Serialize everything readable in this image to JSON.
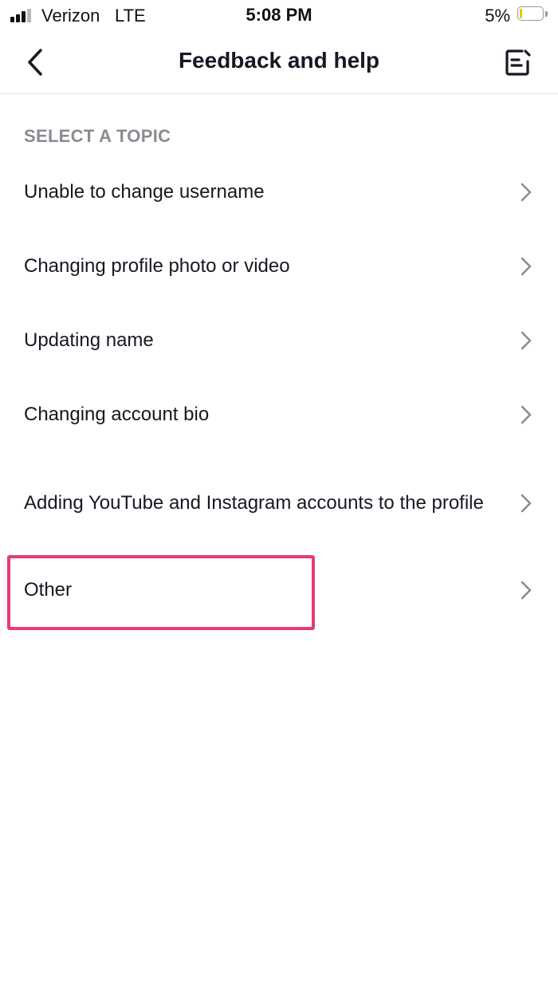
{
  "status_bar": {
    "carrier": "Verizon",
    "network": "LTE",
    "time": "5:08 PM",
    "battery_percent": "5%",
    "battery_level": 0.05,
    "signal_icon": "cellular-signal-icon",
    "battery_icon": "battery-low-icon"
  },
  "nav": {
    "title": "Feedback and help",
    "back_icon": "chevron-left-icon",
    "compose_icon": "edit-note-icon"
  },
  "section": {
    "header": "SELECT A TOPIC"
  },
  "topics": [
    {
      "label": "Unable to change username"
    },
    {
      "label": "Changing profile photo or video"
    },
    {
      "label": "Updating name"
    },
    {
      "label": "Changing account bio"
    },
    {
      "label": "Adding YouTube and Instagram accounts to the profile"
    },
    {
      "label": "Other"
    }
  ],
  "highlight_color": "#e83a74"
}
